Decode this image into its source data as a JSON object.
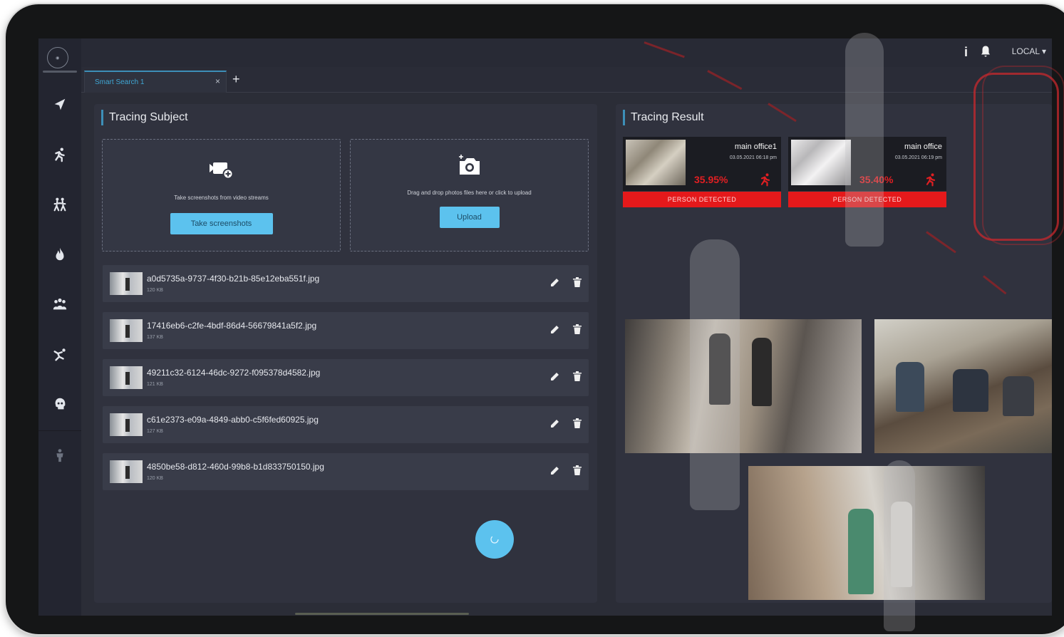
{
  "header": {
    "local_label": "LOCAL ▾",
    "info_symbol": "i"
  },
  "tabs": {
    "active": "Smart Search 1",
    "close": "×",
    "add": "+"
  },
  "subject": {
    "title": "Tracing Subject",
    "screenshot_box": {
      "text": "Take screenshots from video streams",
      "button": "Take screenshots"
    },
    "upload_box": {
      "text": "Drag and drop photos files here or click to upload",
      "button": "Upload"
    },
    "files": [
      {
        "name": "a0d5735a-9737-4f30-b21b-85e12eba551f.jpg",
        "size": "120 KB"
      },
      {
        "name": "17416eb6-c2fe-4bdf-86d4-56679841a5f2.jpg",
        "size": "137 KB"
      },
      {
        "name": "49211c32-6124-46dc-9272-f095378d4582.jpg",
        "size": "121 KB"
      },
      {
        "name": "c61e2373-e09a-4849-abb0-c5f6fed60925.jpg",
        "size": "127 KB"
      },
      {
        "name": "4850be58-d812-460d-99b8-b1d833750150.jpg",
        "size": "120 KB"
      }
    ]
  },
  "result": {
    "title": "Tracing Result",
    "cards": [
      {
        "location": "main office1",
        "date": "03.05.2021 06:18 pm",
        "percent": "35.95%",
        "banner": "PERSON DETECTED"
      },
      {
        "location": "main office",
        "date": "03.05.2021 06:19 pm",
        "percent": "35.40%",
        "banner": "PERSON DETECTED"
      }
    ]
  },
  "colors": {
    "accent": "#5cc2ee",
    "alert": "#e5191b",
    "background": "#2b2d37",
    "sidebar": "#232530"
  }
}
